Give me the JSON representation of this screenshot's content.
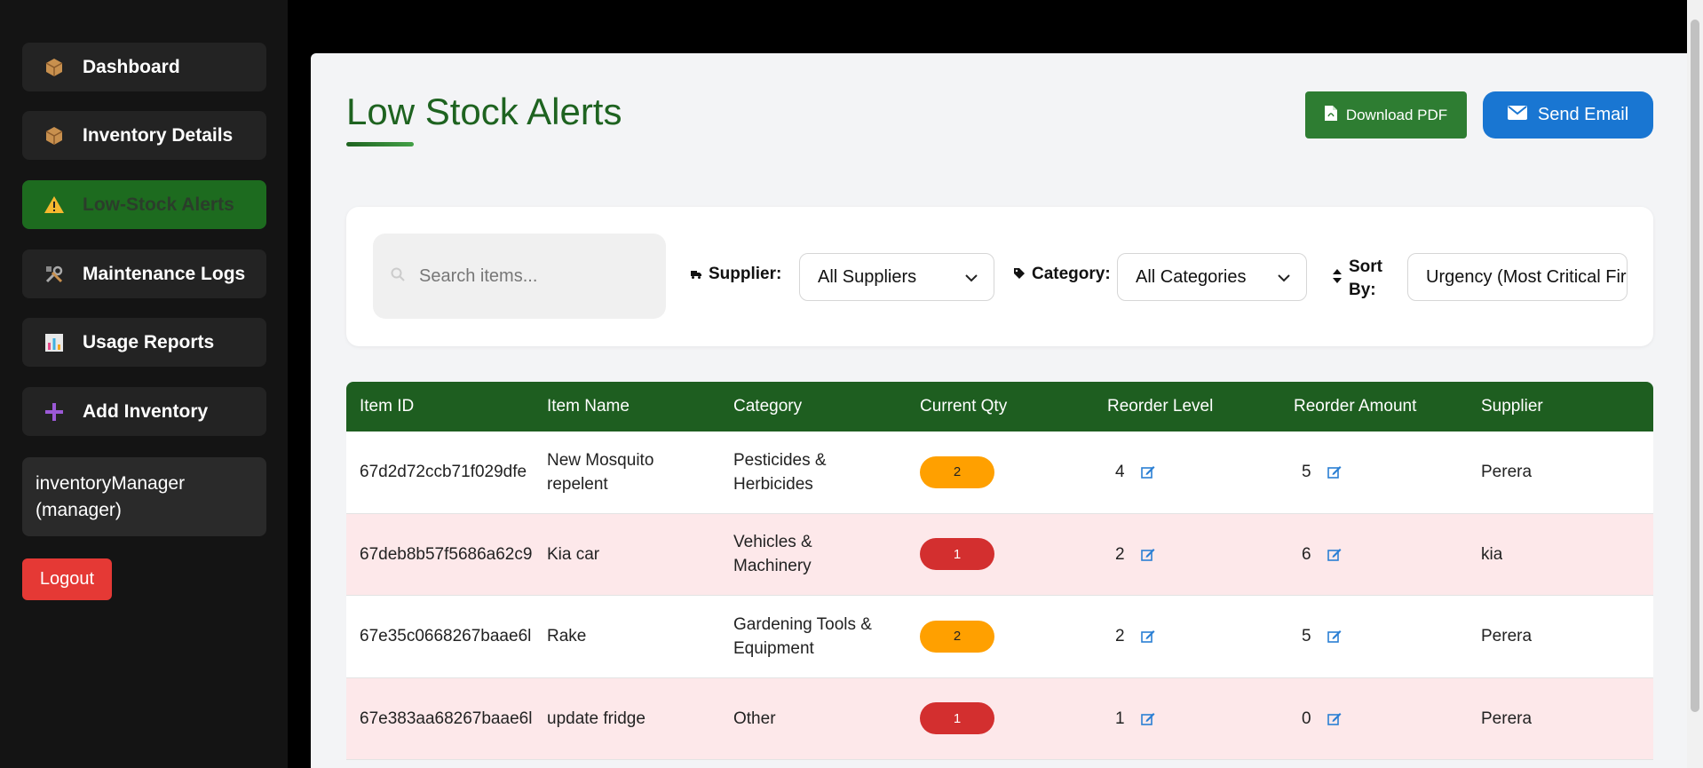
{
  "sidebar": {
    "items": [
      {
        "label": "Dashboard",
        "icon": "package-icon"
      },
      {
        "label": "Inventory Details",
        "icon": "package-icon"
      },
      {
        "label": "Low-Stock Alerts",
        "icon": "warning-icon",
        "active": true
      },
      {
        "label": "Maintenance Logs",
        "icon": "tools-icon"
      },
      {
        "label": "Usage Reports",
        "icon": "bar-chart-icon"
      },
      {
        "label": "Add Inventory",
        "icon": "plus-icon"
      }
    ],
    "user_line1": "inventoryManager",
    "user_line2": "(manager)",
    "logout_label": "Logout"
  },
  "header": {
    "title": "Low Stock Alerts",
    "download_pdf_label": "Download PDF",
    "send_email_label": "Send Email"
  },
  "filters": {
    "search_placeholder": "Search items...",
    "supplier_label": "Supplier:",
    "supplier_value": "All Suppliers",
    "category_label": "Category:",
    "category_value": "All Categories",
    "sort_label_line1": "Sort",
    "sort_label_line2": "By:",
    "sort_value": "Urgency (Most Critical First)"
  },
  "table": {
    "columns": [
      "Item ID",
      "Item Name",
      "Category",
      "Current Qty",
      "Reorder Level",
      "Reorder Amount",
      "Supplier"
    ],
    "rows": [
      {
        "id": "67d2d72ccb71f029dfe",
        "name_l1": "New Mosquito",
        "name_l2": "repelent",
        "cat_l1": "Pesticides &",
        "cat_l2": "Herbicides",
        "qty": "2",
        "qty_status": "orange",
        "reorder_level": "4",
        "reorder_amount": "5",
        "supplier": "Perera"
      },
      {
        "id": "67deb8b57f5686a62c9",
        "name_l1": "Kia car",
        "name_l2": "",
        "cat_l1": "Vehicles &",
        "cat_l2": "Machinery",
        "qty": "1",
        "qty_status": "red",
        "reorder_level": "2",
        "reorder_amount": "6",
        "supplier": "kia"
      },
      {
        "id": "67e35c0668267baae6l",
        "name_l1": "Rake",
        "name_l2": "",
        "cat_l1": "Gardening Tools &",
        "cat_l2": "Equipment",
        "qty": "2",
        "qty_status": "orange",
        "reorder_level": "2",
        "reorder_amount": "5",
        "supplier": "Perera"
      },
      {
        "id": "67e383aa68267baae6l",
        "name_l1": "update fridge",
        "name_l2": "",
        "cat_l1": "Other",
        "cat_l2": "",
        "qty": "1",
        "qty_status": "red",
        "reorder_level": "1",
        "reorder_amount": "0",
        "supplier": "Perera"
      }
    ]
  },
  "colors": {
    "accent_green": "#1e6320",
    "table_header": "#1e5e20",
    "email_blue": "#1976d2",
    "badge_orange": "#ffa000",
    "badge_red": "#d32f2f",
    "logout_red": "#e53935"
  }
}
